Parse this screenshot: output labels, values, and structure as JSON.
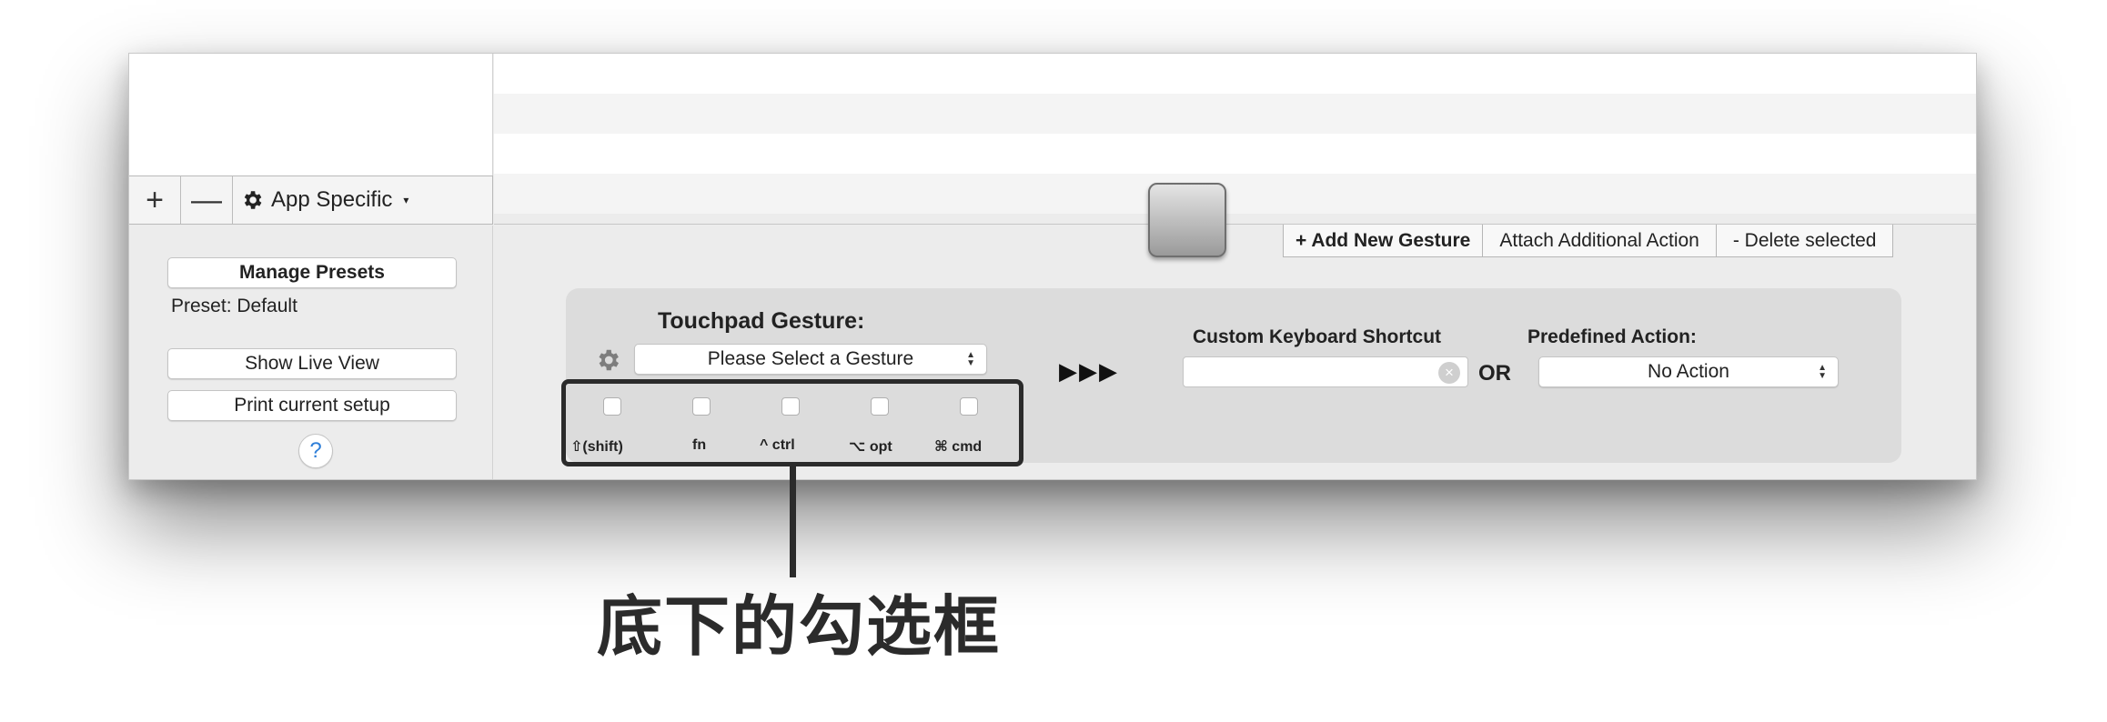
{
  "sidebar": {
    "add_label": "+",
    "remove_label": "—",
    "app_specific_label": "App Specific",
    "app_specific_caret": "▾",
    "manage_presets_label": "Manage Presets",
    "preset_label": "Preset: Default",
    "show_live_view_label": "Show Live View",
    "print_setup_label": "Print current setup",
    "help_label": "?"
  },
  "actions": {
    "add_gesture_label": "+ Add New Gesture",
    "attach_action_label": "Attach Additional Action",
    "delete_label": "- Delete selected"
  },
  "gesture_panel": {
    "touchpad_title": "Touchpad Gesture:",
    "gesture_select_value": "Please Select a Gesture",
    "arrows_label": "▶▶▶",
    "shortcut_title": "Custom Keyboard Shortcut",
    "shortcut_value": "",
    "or_label": "OR",
    "predefined_title": "Predefined Action:",
    "predefined_value": "No Action",
    "modifiers": [
      {
        "label": "⇧(shift)",
        "checked": false
      },
      {
        "label": "fn",
        "checked": false
      },
      {
        "label": "^ ctrl",
        "checked": false
      },
      {
        "label": "⌥ opt",
        "checked": false
      },
      {
        "label": "⌘ cmd",
        "checked": false
      }
    ]
  },
  "annotation": {
    "callout_text": "底下的勾选框"
  },
  "colors": {
    "window_bg": "#ececec",
    "panel_bg": "#dcdcdc",
    "annotation": "#2b2b2b",
    "help_accent": "#2f7fd8"
  }
}
